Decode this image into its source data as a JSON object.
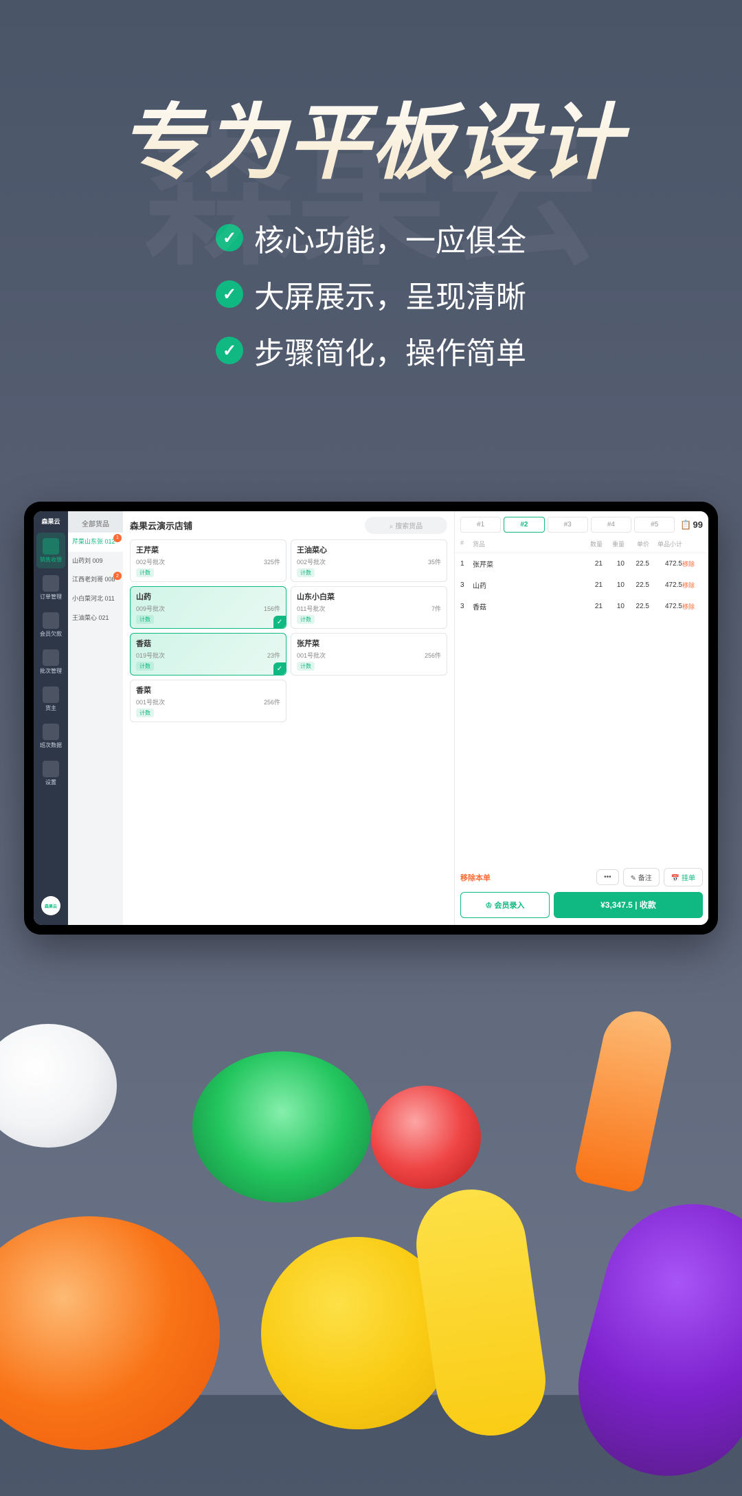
{
  "bg_watermark": "森果云",
  "hero_title": "专为平板设计",
  "features": [
    "核心功能，一应俱全",
    "大屏展示，呈现清晰",
    "步骤简化，操作简单"
  ],
  "sidenav": {
    "logo": "森果云",
    "items": [
      {
        "label": "销售收银",
        "active": true
      },
      {
        "label": "订单管理"
      },
      {
        "label": "会员欠款"
      },
      {
        "label": "批次管理"
      },
      {
        "label": "货主"
      },
      {
        "label": "班次数据"
      },
      {
        "label": "设置"
      }
    ],
    "avatar_text": "森果云"
  },
  "store_title": "森果云演示店铺",
  "search_placeholder": "搜索货品",
  "categories": {
    "header": "全部货品",
    "items": [
      {
        "name": "芹菜山东张\n012",
        "active": true,
        "badge": "1"
      },
      {
        "name": "山药刘\n009"
      },
      {
        "name": "江西老刘哥\n008",
        "badge": "2"
      },
      {
        "name": "小白菜河北\n011"
      },
      {
        "name": "王油菜心\n021"
      }
    ]
  },
  "products": [
    {
      "name": "王芹菜",
      "batch": "002号批次",
      "qty": "325件",
      "tag": "计数"
    },
    {
      "name": "王油菜心",
      "batch": "002号批次",
      "qty": "35件",
      "tag": "计数"
    },
    {
      "name": "山药",
      "batch": "009号批次",
      "qty": "156件",
      "tag": "计数",
      "selected": true
    },
    {
      "name": "山东小白菜",
      "batch": "011号批次",
      "qty": "7件",
      "tag": "计数"
    },
    {
      "name": "香菇",
      "batch": "019号批次",
      "qty": "23件",
      "tag": "计数",
      "selected": true
    },
    {
      "name": "张芹菜",
      "batch": "001号批次",
      "qty": "256件",
      "tag": "计数"
    },
    {
      "name": "香菜",
      "batch": "001号批次",
      "qty": "256件",
      "tag": "计数"
    }
  ],
  "cart": {
    "tabs": [
      "#1",
      "#2",
      "#3",
      "#4",
      "#5"
    ],
    "active_tab": 1,
    "count": "99",
    "headers": [
      "#",
      "货品",
      "数量",
      "重量",
      "单价",
      "单品小计",
      ""
    ],
    "rows": [
      {
        "idx": "1",
        "name": "张芹菜",
        "qty": "21",
        "wt": "10",
        "price": "22.5",
        "sub": "472.5"
      },
      {
        "idx": "3",
        "name": "山药",
        "qty": "21",
        "wt": "10",
        "price": "22.5",
        "sub": "472.5"
      },
      {
        "idx": "3",
        "name": "香菇",
        "qty": "21",
        "wt": "10",
        "price": "22.5",
        "sub": "472.5"
      }
    ],
    "remove_label": "移除",
    "remove_order": "移除本单",
    "more": "•••",
    "note": "备注",
    "hold": "挂单",
    "member": "会员录入",
    "pay_total": "¥3,347.5",
    "pay_label": "收款"
  }
}
